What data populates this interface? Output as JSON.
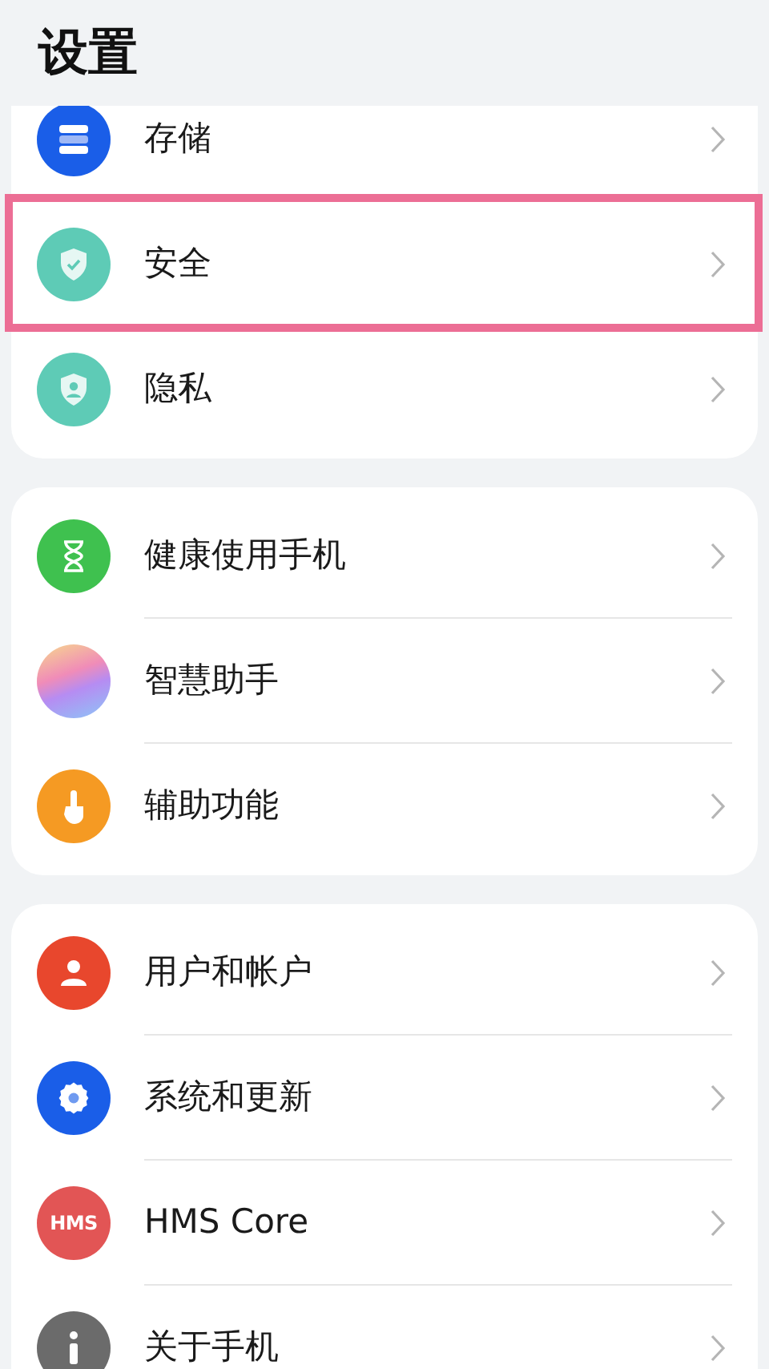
{
  "title": "设置",
  "groups": [
    {
      "items": [
        {
          "label": "存储",
          "highlighted": false
        },
        {
          "label": "安全",
          "highlighted": true
        },
        {
          "label": "隐私",
          "highlighted": false
        }
      ]
    },
    {
      "items": [
        {
          "label": "健康使用手机",
          "highlighted": false
        },
        {
          "label": "智慧助手",
          "highlighted": false
        },
        {
          "label": "辅助功能",
          "highlighted": false
        }
      ]
    },
    {
      "items": [
        {
          "label": "用户和帐户",
          "highlighted": false
        },
        {
          "label": "系统和更新",
          "highlighted": false
        },
        {
          "label": "HMS Core",
          "highlighted": false,
          "icon_text": "HMS"
        },
        {
          "label": "关于手机",
          "highlighted": false
        }
      ]
    }
  ]
}
